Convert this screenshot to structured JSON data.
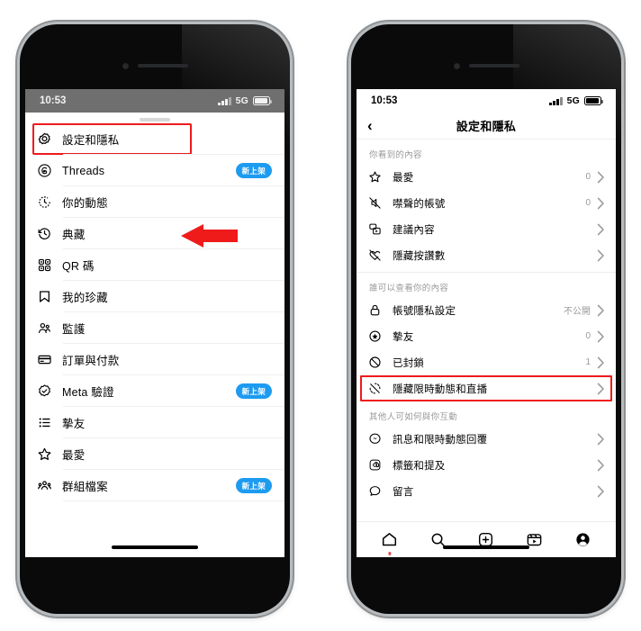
{
  "meta": {
    "accent_blue": "#1d9bf0",
    "highlight_red": "#ef1b1b",
    "notification_red": "#ed4956"
  },
  "left_phone": {
    "status_bar": {
      "time": "10:53",
      "network": "5G"
    },
    "sheet_title_hidden": "",
    "menu_items": [
      {
        "icon": "settings-gear-icon",
        "label": "設定和隱私",
        "badge": "",
        "highlighted": true
      },
      {
        "icon": "threads-icon",
        "label": "Threads",
        "badge": "新上架",
        "highlighted": false
      },
      {
        "icon": "your-activity-icon",
        "label": "你的動態",
        "badge": "",
        "highlighted": false
      },
      {
        "icon": "archive-icon",
        "label": "典藏",
        "badge": "",
        "highlighted": false
      },
      {
        "icon": "qr-code-icon",
        "label": "QR 碼",
        "badge": "",
        "highlighted": false
      },
      {
        "icon": "bookmark-icon",
        "label": "我的珍藏",
        "badge": "",
        "highlighted": false
      },
      {
        "icon": "supervision-icon",
        "label": "監護",
        "badge": "",
        "highlighted": false
      },
      {
        "icon": "orders-payments-icon",
        "label": "訂單與付款",
        "badge": "",
        "highlighted": false
      },
      {
        "icon": "meta-verified-icon",
        "label": "Meta 驗證",
        "badge": "新上架",
        "highlighted": false
      },
      {
        "icon": "close-friends-icon",
        "label": "摯友",
        "badge": "",
        "highlighted": false
      },
      {
        "icon": "star-icon",
        "label": "最愛",
        "badge": "",
        "highlighted": false
      },
      {
        "icon": "group-profile-icon",
        "label": "群組檔案",
        "badge": "新上架",
        "highlighted": false
      }
    ],
    "annotation": {
      "arrow": "left-pointing-red-arrow"
    }
  },
  "right_phone": {
    "status_bar": {
      "time": "10:53",
      "network": "5G"
    },
    "nav": {
      "back": "‹",
      "title": "設定和隱私"
    },
    "sections": [
      {
        "header": "你看到的內容",
        "rows": [
          {
            "icon": "star-icon",
            "label": "最愛",
            "value": "0",
            "highlighted": false
          },
          {
            "icon": "muted-accounts-icon",
            "label": "噤聲的帳號",
            "value": "0",
            "highlighted": false
          },
          {
            "icon": "suggested-content-icon",
            "label": "建議內容",
            "value": "",
            "highlighted": false
          },
          {
            "icon": "hide-likes-icon",
            "label": "隱藏按讚數",
            "value": "",
            "highlighted": false
          }
        ]
      },
      {
        "header": "誰可以查看你的內容",
        "rows": [
          {
            "icon": "lock-icon",
            "label": "帳號隱私設定",
            "value": "不公開",
            "highlighted": false
          },
          {
            "icon": "close-friends-icon",
            "label": "摯友",
            "value": "0",
            "highlighted": false
          },
          {
            "icon": "blocked-icon",
            "label": "已封鎖",
            "value": "1",
            "highlighted": false
          },
          {
            "icon": "hide-story-icon",
            "label": "隱藏限時動態和直播",
            "value": "",
            "highlighted": true
          }
        ]
      },
      {
        "header": "其他人可如何與你互動",
        "rows": [
          {
            "icon": "messages-icon",
            "label": "訊息和限時動態回覆",
            "value": "",
            "highlighted": false
          },
          {
            "icon": "tags-icon",
            "label": "標籤和提及",
            "value": "",
            "highlighted": false
          },
          {
            "icon": "comments-icon",
            "label": "留言",
            "value": "",
            "highlighted": false
          }
        ]
      }
    ],
    "tabbar": [
      {
        "icon": "home-icon",
        "label": "首頁",
        "dot": true
      },
      {
        "icon": "search-icon",
        "label": "搜尋",
        "dot": false
      },
      {
        "icon": "create-icon",
        "label": "建立",
        "dot": false
      },
      {
        "icon": "reels-icon",
        "label": "連續短片",
        "dot": false
      },
      {
        "icon": "profile-icon",
        "label": "個人檔案",
        "dot": false
      }
    ]
  }
}
